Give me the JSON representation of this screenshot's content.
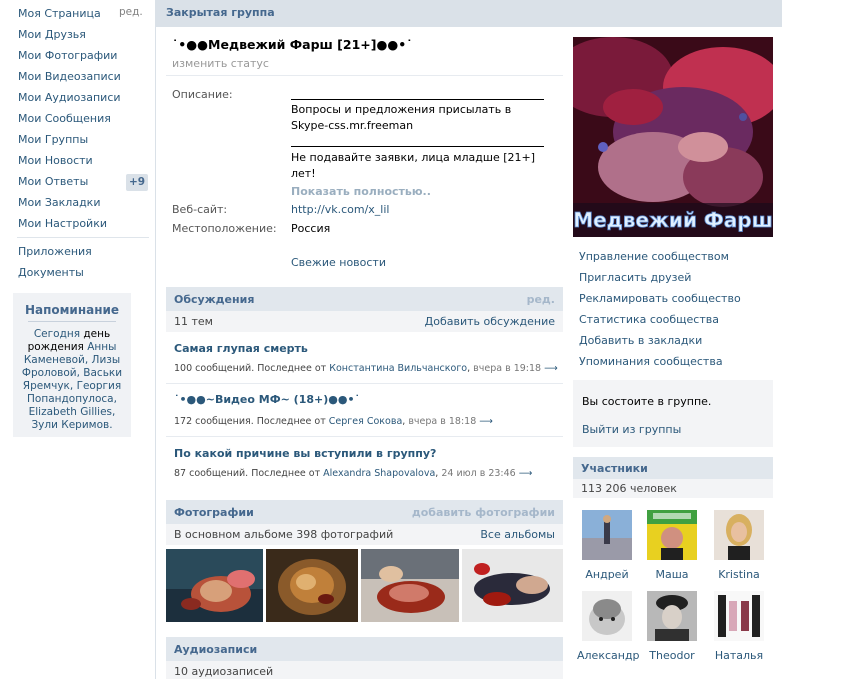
{
  "nav": {
    "items": [
      {
        "label": "Моя Страница"
      },
      {
        "label": "Мои Друзья"
      },
      {
        "label": "Мои Фотографии"
      },
      {
        "label": "Мои Видеозаписи"
      },
      {
        "label": "Мои Аудиозаписи"
      },
      {
        "label": "Мои Сообщения"
      },
      {
        "label": "Мои Группы"
      },
      {
        "label": "Мои Новости"
      },
      {
        "label": "Мои Ответы"
      },
      {
        "label": "Мои Закладки"
      },
      {
        "label": "Мои Настройки"
      }
    ],
    "edit_label": "ред.",
    "answers_badge": "+9",
    "extra": [
      {
        "label": "Приложения"
      },
      {
        "label": "Документы"
      }
    ]
  },
  "reminder": {
    "title": "Напоминание",
    "today": "Сегодня",
    "bday_word": "день рождения",
    "names": "Анны Каменевой, Лизы Фроловой, Васьки Яремчук, Георгия Попандопулоса, Elizabeth Gillies, Зули Керимов."
  },
  "header": {
    "title": "Закрытая группа"
  },
  "group": {
    "name": "˙•●●Медвежий Фарш [21+]●●•˙",
    "status_link": "изменить статус",
    "description_label": "Описание:",
    "description_1": "Вопросы и предложения присылать в Skype-css.mr.freeman",
    "description_2": "Не подавайте заявки, лица младше [21+] лет!",
    "show_full": "Показать полностью..",
    "website_label": "Веб-сайт:",
    "website": "http://vk.com/x_lil",
    "location_label": "Местоположение:",
    "location": "Россия",
    "fresh_news": "Свежие новости",
    "cover_text": "Медвежий Фарш"
  },
  "discussions": {
    "title": "Обсуждения",
    "edit": "ред.",
    "count": "11 тем",
    "add": "Добавить обсуждение",
    "topics": [
      {
        "title": "Самая глупая смерть",
        "msgs": "100 сообщений. Последнее от",
        "author": "Константина Вильчанского",
        "time": "вчера в 19:18"
      },
      {
        "title": "˙•●●~Видео МФ~ (18+)●●•˙",
        "msgs": "172 сообщения. Последнее от",
        "author": "Сергея Сокова",
        "time": "вчера в 18:18"
      },
      {
        "title": "По какой причине вы вступили в группу?",
        "msgs": "87 сообщений. Последнее от",
        "author": "Alexandra Shapovalova",
        "time": "24 июл в 23:46"
      }
    ]
  },
  "photos": {
    "title": "Фотографии",
    "add": "добавить фотографии",
    "summary": "В основном альбоме 398 фотографий",
    "all": "Все альбомы"
  },
  "audio": {
    "title": "Аудиозаписи",
    "count": "10 аудиозаписей"
  },
  "actions": [
    {
      "label": "Управление сообществом"
    },
    {
      "label": "Пригласить друзей"
    },
    {
      "label": "Рекламировать сообщество"
    },
    {
      "label": "Статистика сообщества"
    },
    {
      "label": "Добавить в закладки"
    },
    {
      "label": "Упоминания сообщества"
    }
  ],
  "membership": {
    "status": "Вы состоите в группе.",
    "leave": "Выйти из группы"
  },
  "members": {
    "title": "Участники",
    "count": "113 206 человек",
    "list": [
      {
        "name": "Андрей"
      },
      {
        "name": "Маша"
      },
      {
        "name": "Kristina"
      },
      {
        "name": "Александр"
      },
      {
        "name": "Theodor"
      },
      {
        "name": "Наталья"
      }
    ]
  },
  "arrow": "⟶"
}
